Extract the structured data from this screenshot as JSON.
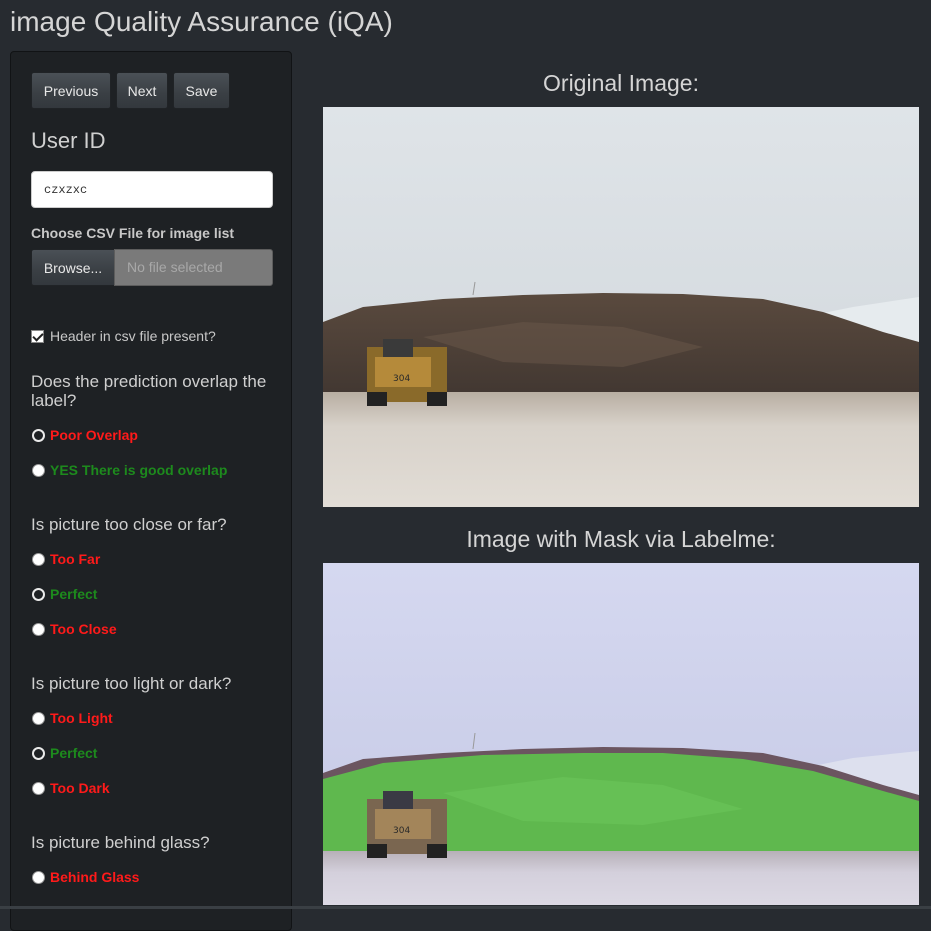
{
  "app": {
    "title": "image Quality Assurance (iQA)"
  },
  "toolbar": {
    "previous": "Previous",
    "next": "Next",
    "save": "Save"
  },
  "user": {
    "label": "User ID",
    "value": "czxzxc"
  },
  "csv": {
    "label": "Choose CSV File for image list",
    "browse": "Browse...",
    "file_placeholder": "No file selected",
    "header_checkbox_label": "Header in csv file present?",
    "header_checked": true
  },
  "questions": [
    {
      "text": "Does the prediction overlap the label?",
      "options": [
        {
          "label": "Poor Overlap",
          "color": "#ff1a1a",
          "selected": true
        },
        {
          "label": "YES There is good overlap",
          "color": "#1d8a1d",
          "selected": false
        }
      ]
    },
    {
      "text": "Is picture too close or far?",
      "options": [
        {
          "label": "Too Far",
          "color": "#ff1a1a",
          "selected": false
        },
        {
          "label": "Perfect",
          "color": "#1d8a1d",
          "selected": true
        },
        {
          "label": "Too Close",
          "color": "#ff1a1a",
          "selected": false
        }
      ]
    },
    {
      "text": "Is picture too light or dark?",
      "options": [
        {
          "label": "Too Light",
          "color": "#ff1a1a",
          "selected": false
        },
        {
          "label": "Perfect",
          "color": "#1d8a1d",
          "selected": true
        },
        {
          "label": "Too Dark",
          "color": "#ff1a1a",
          "selected": false
        }
      ]
    },
    {
      "text": "Is picture behind glass?",
      "options": [
        {
          "label": "Behind Glass",
          "color": "#ff1a1a",
          "selected": false
        }
      ]
    }
  ],
  "images": {
    "original_title": "Original Image:",
    "mask_title": "Image with Mask via Labelme:",
    "truck_number": "304"
  },
  "colors": {
    "background": "#272b30",
    "sidebar": "#1e2124",
    "negative": "#ff1a1a",
    "positive": "#1d8a1d"
  }
}
